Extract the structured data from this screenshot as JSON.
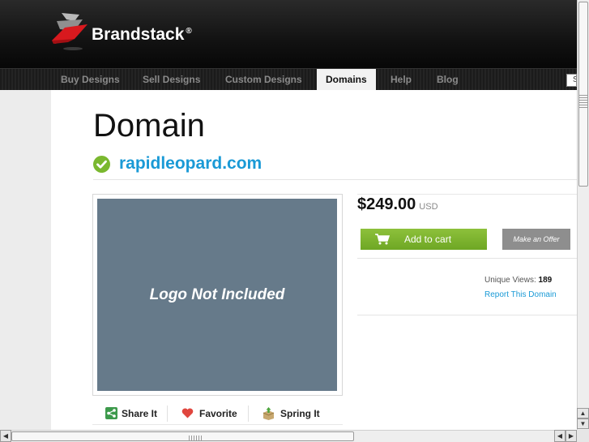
{
  "brand": {
    "name": "Brandstack",
    "registered": "®"
  },
  "nav": {
    "items": [
      "Buy Designs",
      "Sell Designs",
      "Custom Designs",
      "Domains",
      "Help",
      "Blog"
    ],
    "active": "Domains",
    "search_value": "S"
  },
  "page": {
    "title": "Domain",
    "domain_name": "rapidleopard.com",
    "logo_placeholder": "Logo Not Included"
  },
  "share": {
    "share_label": "Share It",
    "favorite_label": "Favorite",
    "spring_label": "Spring It"
  },
  "purchase": {
    "price": "$249.00",
    "currency": "USD",
    "add_to_cart": "Add to cart",
    "make_offer": "Make an Offer"
  },
  "stats": {
    "views_label": "Unique Views:",
    "views_count": "189",
    "report_label": "Report This Domain"
  },
  "colors": {
    "accent_blue": "#1a9ad6",
    "cart_green": "#7ab82f",
    "placeholder_gray": "#667a8a"
  }
}
